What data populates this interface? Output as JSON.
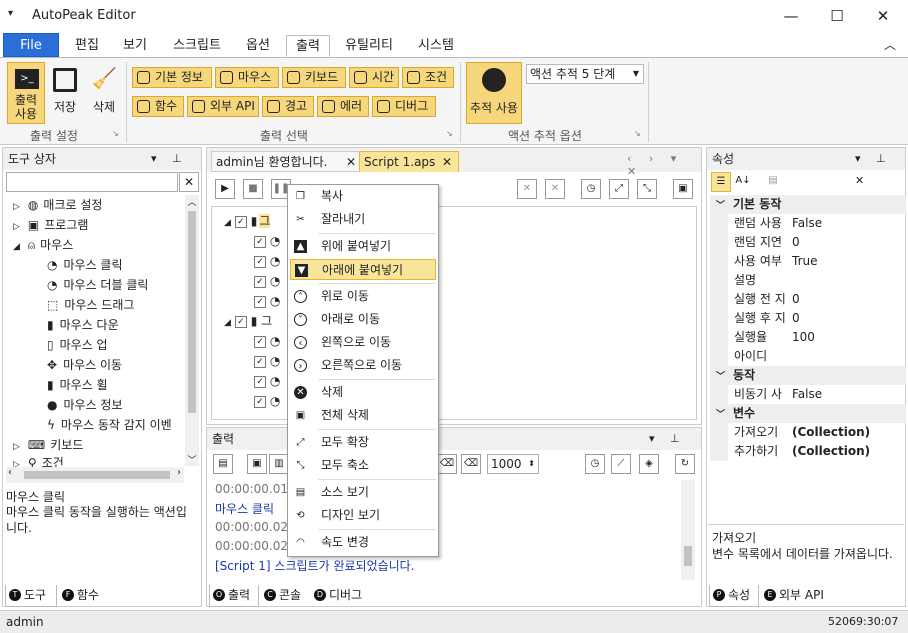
{
  "app": {
    "title": "AutoPeak Editor"
  },
  "tabs": [
    "File",
    "편집",
    "보기",
    "스크립트",
    "옵션",
    "출력",
    "유틸리티",
    "시스템"
  ],
  "ribbon": {
    "output_use": "출력\n사용",
    "save": "저장",
    "clean": "삭제",
    "group1": "출력 설정",
    "buttons_row1": [
      "기본 정보",
      "마우스",
      "키보드",
      "시간",
      "조건"
    ],
    "buttons_row2": [
      "함수",
      "외부 API",
      "경고",
      "에러",
      "디버그"
    ],
    "group2": "출력 선택",
    "trace_use": "추적 사용",
    "trace_select": "액션 추적 5 단계",
    "group3": "액션 추적 옵션"
  },
  "toolbox": {
    "title": "도구 상자",
    "items": [
      "매크로 설정",
      "프로그램",
      "마우스",
      "마우스 클릭",
      "마우스 더블 클릭",
      "마우스 드래그",
      "마우스 다운",
      "마우스 업",
      "마우스 이동",
      "마우스 휠",
      "마우스 정보",
      "마우스 동작 감지 이벤",
      "키보드",
      "조건"
    ],
    "desc_title": "마우스 클릭",
    "desc_text": "마우스 클릭 동작을 실행하는 액션입니다.",
    "tab_tools": "도구",
    "tab_funcs": "함수"
  },
  "doc_tabs": [
    "admin님 환영합니다.",
    "Script 1.aps"
  ],
  "script_tree": {
    "group_label": "그룹",
    "group_prefix": "그"
  },
  "output": {
    "title": "출력",
    "speed": "1000",
    "lines": [
      "00:00:00.016",
      "마우스 클릭",
      "00:00:00.027",
      "00:00:00.021",
      "[Script 1] 스크립트가 완료되었습니다."
    ],
    "tabs": [
      "출력",
      "콘솔",
      "디버그"
    ]
  },
  "context_menu": [
    "복사",
    "잘라내기",
    "위에 붙여넣기",
    "아래에 붙여넣기",
    "위로 이동",
    "아래로 이동",
    "왼쪽으로 이동",
    "오른쪽으로 이동",
    "삭제",
    "전체 삭제",
    "모두 확장",
    "모두 축소",
    "소스 보기",
    "디자인 보기",
    "속도 변경"
  ],
  "properties": {
    "title": "속성",
    "cat1": "기본 동작",
    "rows1": [
      [
        "랜덤 사용",
        "False"
      ],
      [
        "랜덤 지연",
        "0"
      ],
      [
        "사용 여부",
        "True"
      ],
      [
        "설명",
        ""
      ],
      [
        "실행 전 지",
        "0"
      ],
      [
        "실행 후 지",
        "0"
      ],
      [
        "실행율",
        "100"
      ],
      [
        "아이디",
        ""
      ]
    ],
    "cat2": "동작",
    "rows2": [
      [
        "비동기 사",
        "False"
      ]
    ],
    "cat3": "변수",
    "rows3": [
      [
        "가져오기",
        "(Collection)"
      ],
      [
        "추가하기",
        "(Collection)"
      ]
    ],
    "desc_title": "가져오기",
    "desc_text": "변수 목록에서 데이터를 가져옵니다.",
    "tab_props": "속성",
    "tab_api": "외부 API"
  },
  "status": {
    "user": "admin",
    "time": "52069:30:07"
  }
}
